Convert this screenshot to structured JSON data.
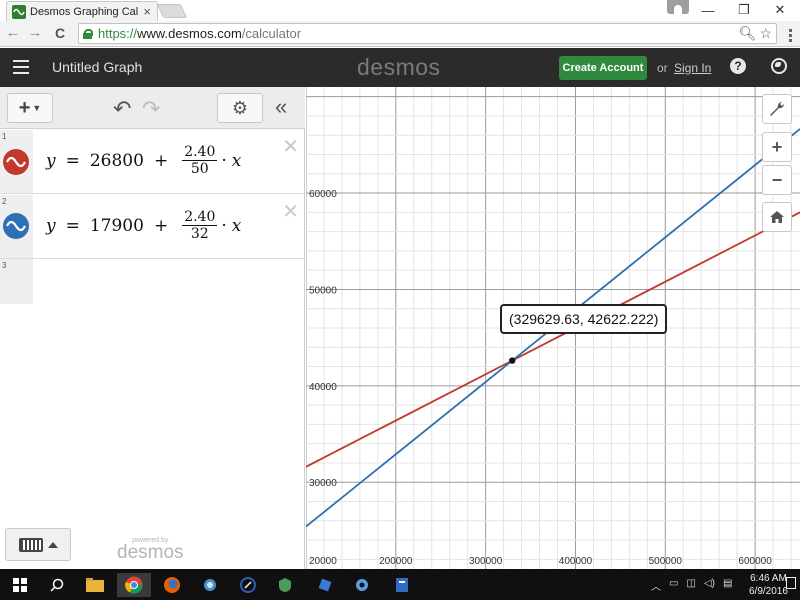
{
  "browser": {
    "tab_title": "Desmos Graphing Calculator",
    "tab_close": "×",
    "url_scheme": "https://",
    "url_host": "www.desmos.com",
    "url_path": "/calculator",
    "win_minimize": "—",
    "win_restore": "❐",
    "win_close": "✕",
    "nav_back": "←",
    "nav_forward": "→",
    "nav_reload": "C"
  },
  "header": {
    "graph_title": "Untitled Graph",
    "brand": "desmos",
    "create_account": "Create Account",
    "or": "or",
    "sign_in": "Sign In",
    "help": "?"
  },
  "toolbar": {
    "add": "+",
    "undo": "↶",
    "redo": "↷",
    "settings": "⚙",
    "collapse": "«"
  },
  "expressions": [
    {
      "index": "1",
      "lhs": "y",
      "eq": "=",
      "constant": "26800",
      "plus": "+",
      "numerator": "2.40",
      "denominator": "50",
      "dot": "·",
      "var": "x",
      "color": "#c0392b"
    },
    {
      "index": "2",
      "lhs": "y",
      "eq": "=",
      "constant": "17900",
      "plus": "+",
      "numerator": "2.40",
      "denominator": "32",
      "dot": "·",
      "var": "x",
      "color": "#2d70b3"
    }
  ],
  "empty_row_index": "3",
  "delete_glyph": "✕",
  "footer": {
    "powered_by": "powered by",
    "brand": "desmos"
  },
  "graph": {
    "x_ticks": [
      "20000",
      "200000",
      "300000",
      "400000",
      "500000",
      "600000"
    ],
    "y_ticks": [
      "30000",
      "40000",
      "50000",
      "60000"
    ],
    "intersection_label": "(329629.63, 42622.222)",
    "zoom_in": "+",
    "zoom_out": "−",
    "wrench": "🔧",
    "home": "⌂"
  },
  "chart_data": {
    "type": "line",
    "series": [
      {
        "label_expr": "y = 26800 + 2.40/50 · x",
        "intercept": 26800,
        "slope": 0.048,
        "color": "#c0392b"
      },
      {
        "label_expr": "y = 17900 + 2.40/32 · x",
        "intercept": 17900,
        "slope": 0.075,
        "color": "#2d70b3"
      }
    ],
    "intersection": {
      "x": 329629.63,
      "y": 42622.222
    },
    "xlim": [
      100000,
      650000
    ],
    "ylim": [
      21000,
      71000
    ],
    "grid": true
  },
  "taskbar": {
    "time": "6:46 AM",
    "date": "6/9/2016"
  }
}
